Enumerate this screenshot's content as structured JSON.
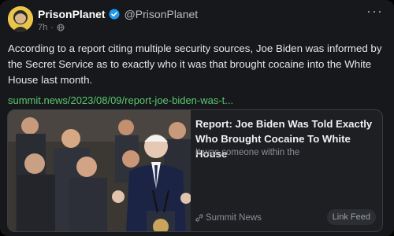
{
  "post": {
    "author_name": "PrisonPlanet",
    "author_handle": "@PrisonPlanet",
    "timestamp": "7h",
    "meta_separator": "·",
    "menu_glyph": "···",
    "text": "According to a report citing multiple security sources, Joe Biden was informed by the Secret Service as to exactly who it was that brought cocaine into the White House last month.",
    "link_text": "summit.news/2023/08/09/report-joe-biden-was-t..."
  },
  "preview": {
    "title": "Report: Joe Biden Was Told Exactly Who Brought Cocaine To White House",
    "description": "It was someone within the",
    "source": "Summit News",
    "action_label": "Link Feed"
  },
  "icons": {
    "verified": "verified-badge-icon",
    "globe": "globe-icon",
    "link": "link-icon",
    "menu": "more-menu-icon"
  },
  "colors": {
    "link": "#59c86f",
    "verified": "#1d9bf0",
    "background": "#17181b"
  }
}
